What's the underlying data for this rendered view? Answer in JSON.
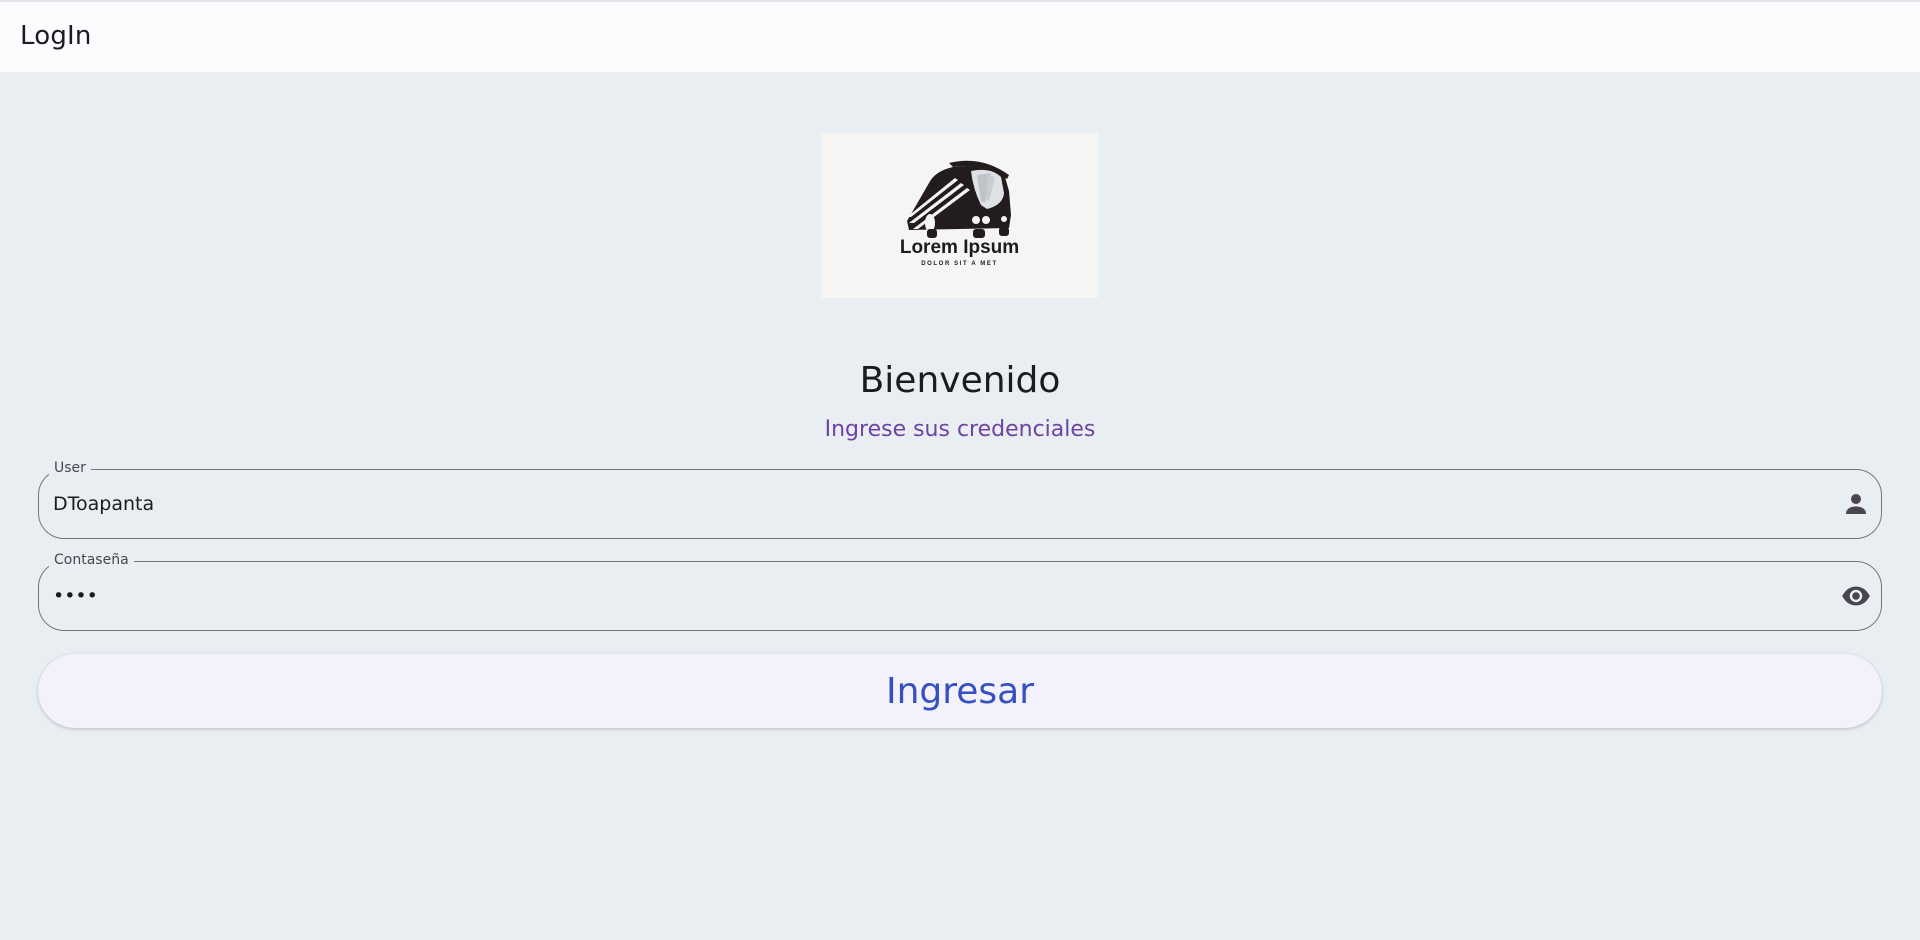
{
  "appbar": {
    "title": "LogIn"
  },
  "logo": {
    "title": "Lorem Ipsum",
    "subtitle": "DOLOR SIT A MET"
  },
  "welcome": {
    "title": "Bienvenido",
    "subtitle": "Ingrese sus credenciales"
  },
  "form": {
    "user": {
      "label": "User",
      "value": "DToapanta",
      "icon": "person-icon"
    },
    "password": {
      "label": "Contaseña",
      "value": "••••",
      "icon": "visibility-icon"
    },
    "submit_label": "Ingresar"
  },
  "colors": {
    "background": "#e8eef1",
    "appbar": "#fdfbfe",
    "subtitle": "#6f43a6",
    "button_text": "#3650c2",
    "button_bg": "#f3f1fb",
    "outline": "#79747e"
  }
}
